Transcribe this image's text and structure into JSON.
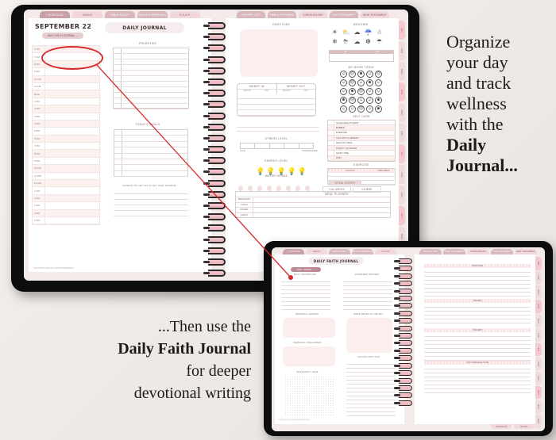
{
  "marketing": {
    "right_text": [
      "Organize",
      "your day",
      "and track",
      "wellness",
      "with the"
    ],
    "right_bold": [
      "Daily",
      "Journal..."
    ],
    "left_text_1": "...Then use the",
    "left_bold": "Daily Faith Journal",
    "left_text_2": "for deeper",
    "left_text_3": "devotional writing"
  },
  "colors": {
    "accent_pink": "#f3d8db",
    "active_tab": "#c8a0a5",
    "callout_red": "#d62a2a",
    "tablet_bezel": "#0d0d0d"
  },
  "daily_journal": {
    "top_tabs_left": [
      "2 Schedule",
      "Goals",
      "Bible Study",
      "Skills & Personal",
      "S.O.A.P."
    ],
    "top_tabs_right": [
      "Prayer List",
      "Time & Offering",
      "Vision Board",
      "Old Testament",
      "New Testament"
    ],
    "date": "September 22",
    "title": "Daily Journal",
    "faith_link": "Daily Faith Journal →",
    "hours": [
      "6 AM",
      "7 AM",
      "8 AM",
      "9 AM",
      "10 AM",
      "11 AM",
      "Noon",
      "1 PM",
      "2 PM",
      "3 PM",
      "4 PM",
      "5 PM",
      "6 PM",
      "7 PM",
      "8 PM",
      "9 PM",
      "10 PM",
      "11 PM",
      "12 AM",
      "1 AM",
      "2 AM",
      "3 AM",
      "4 AM",
      "5 AM"
    ],
    "priorities_label": "Priorities",
    "goals_label": "Today's Goals",
    "let_go_label": "Things to let go & let God handle",
    "gratitude_label": "Gratitude",
    "money_in": "Money In",
    "money_out": "Money Out",
    "money_sub": [
      "Amount",
      "For",
      "Amount",
      "For"
    ],
    "stress_label": "Stress Level",
    "stress_low": "Calm",
    "stress_high": "Overwhelmed",
    "energy_label": "Energy Level",
    "water_label": "Water Intake",
    "meal_label": "Meal Planner",
    "meals": [
      "Breakfast",
      "Lunch",
      "Dinner",
      "Snack"
    ],
    "weather_label": "Weather",
    "weather_icons": [
      "☀",
      "⛅",
      "☁",
      "☔",
      "☃",
      "❄",
      "⛈",
      "☁",
      "❆",
      "☂"
    ],
    "temp_labels": [
      "Hi",
      "Lo"
    ],
    "mood_label": "My Mood Today",
    "mood_faces": [
      "☺",
      "☹",
      "☻",
      "☺",
      "☹",
      "☺",
      "☹",
      "☺",
      "☻",
      "☺",
      "☺",
      "☻",
      "☹",
      "☺",
      "☺",
      "☻",
      "☹",
      "☺",
      "☺",
      "☻",
      "☺",
      "☺",
      "☹",
      "☺",
      "☻"
    ],
    "self_care_label": "Self Care",
    "self_care": [
      "Good night's rest",
      "Bubble",
      "Exercise",
      "Talk with a friend",
      "Healthy meal",
      "Plenty of water",
      "Quiet time",
      "Pray"
    ],
    "exercise_label": "Exercise",
    "exercise_cols": [
      "Activity",
      "Time Spent"
    ],
    "total_steps": "Total Steps",
    "calories": "Calories",
    "carbs": "Carbs",
    "side_tabs": [
      "Jan",
      "Feb",
      "Mar",
      "Apr",
      "May",
      "Jun",
      "Jul",
      "Aug",
      "Sep",
      "Oct",
      "Nov",
      "Dec"
    ],
    "footer": "Copyright 2022 All rights reserved"
  },
  "faith_journal": {
    "top_tabs_left": [
      "2 Schedule",
      "Goals",
      "Bible Study",
      "Skills & Personal",
      "S.O.A.P."
    ],
    "top_tabs_right": [
      "Prayer List",
      "Time & Offering",
      "Vision Board",
      "Old Testament",
      "New Testament"
    ],
    "title": "Daily Faith Journal",
    "back_link": "Daily Journal →",
    "sections_left": [
      "Daily Affirmation",
      "Personal Growth",
      "Personal Challenges",
      "Questions I Have"
    ],
    "sections_mid": [
      "Answered Prayers",
      "Bible Verse of the Day",
      "Talking with God"
    ],
    "sections_right": [
      "Scripture",
      "Praises",
      "Prayers",
      "God's Message to Me"
    ],
    "side_tabs": [
      "Jan",
      "Feb",
      "Mar",
      "Apr",
      "May",
      "Jun",
      "Jul",
      "Aug",
      "Sep",
      "Oct",
      "Nov",
      "Dec"
    ],
    "bottom_tabs": [
      "Contacts",
      "Notes"
    ],
    "footer": "Copyright 2022 All rights reserved"
  }
}
